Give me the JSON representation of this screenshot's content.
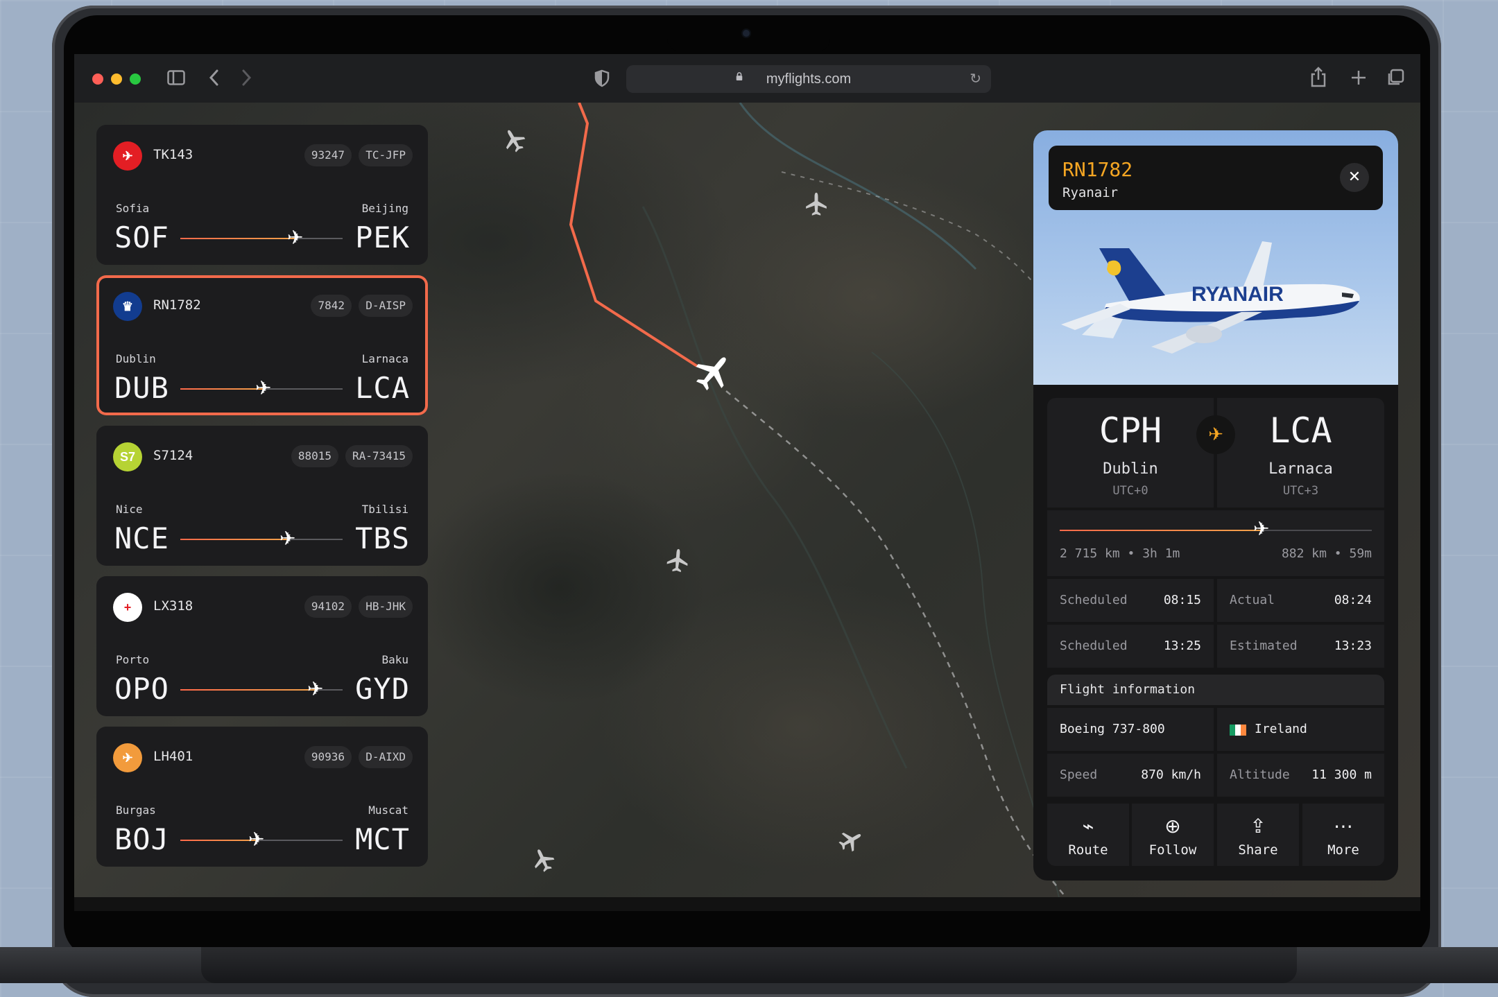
{
  "browser": {
    "url": "myflights.com",
    "sidebar_icon": "sidebar-icon",
    "back_icon": "chevron-left-icon",
    "forward_icon": "chevron-right-icon",
    "shield_icon": "shield-icon",
    "share_icon": "share-icon",
    "new_tab_icon": "plus-icon",
    "tabs_icon": "tabs-overview-icon"
  },
  "flights": [
    {
      "flight": "TK143",
      "badge1": "93247",
      "badge2": "TC-JFP",
      "from_city": "Sofia",
      "from_code": "SOF",
      "to_city": "Beijing",
      "to_code": "PEK",
      "progress": 0.72,
      "logo_color": "#e31e24",
      "logo_text": "✈"
    },
    {
      "flight": "RN1782",
      "badge1": "7842",
      "badge2": "D-AISP",
      "from_city": "Dublin",
      "from_code": "DUB",
      "to_city": "Larnaca",
      "to_code": "LCA",
      "progress": 0.52,
      "logo_color": "#123c8f",
      "logo_text": "♛",
      "selected": true
    },
    {
      "flight": "S7124",
      "badge1": "88015",
      "badge2": "RA-73415",
      "from_city": "Nice",
      "from_code": "NCE",
      "to_city": "Tbilisi",
      "to_code": "TBS",
      "progress": 0.67,
      "logo_color": "#b6d334",
      "logo_text": "S7"
    },
    {
      "flight": "LX318",
      "badge1": "94102",
      "badge2": "HB-JHK",
      "from_city": "Porto",
      "from_code": "OPO",
      "to_city": "Baku",
      "to_code": "GYD",
      "progress": 0.84,
      "logo_color": "#ffffff",
      "logo_text": "+"
    },
    {
      "flight": "LH401",
      "badge1": "90936",
      "badge2": "D-AIXD",
      "from_city": "Burgas",
      "from_code": "BOJ",
      "to_city": "Muscat",
      "to_code": "MCT",
      "progress": 0.48,
      "logo_color": "#f29b3c",
      "logo_text": "✈"
    }
  ],
  "detail": {
    "flight": "RN1782",
    "airline": "Ryanair",
    "photo_brand": "RYANAIR",
    "origin": {
      "code": "CPH",
      "city": "Dublin",
      "tz": "UTC+0"
    },
    "destination": {
      "code": "LCA",
      "city": "Larnaca",
      "tz": "UTC+3"
    },
    "progress": 0.65,
    "flown": "2 715 km • 3h 1m",
    "remaining": "882 km • 59m",
    "times": [
      {
        "label": "Scheduled",
        "value": "08:15"
      },
      {
        "label": "Actual",
        "value": "08:24"
      },
      {
        "label": "Scheduled",
        "value": "13:25"
      },
      {
        "label": "Estimated",
        "value": "13:23"
      }
    ],
    "info_title": "Flight information",
    "aircraft": "Boeing 737-800",
    "country": "Ireland",
    "speed_label": "Speed",
    "speed": "870 km/h",
    "altitude_label": "Altitude",
    "altitude": "11 300 m",
    "actions": [
      {
        "label": "Route",
        "icon": "route-icon"
      },
      {
        "label": "Follow",
        "icon": "target-icon"
      },
      {
        "label": "Share",
        "icon": "share-icon"
      },
      {
        "label": "More",
        "icon": "more-icon"
      }
    ]
  }
}
